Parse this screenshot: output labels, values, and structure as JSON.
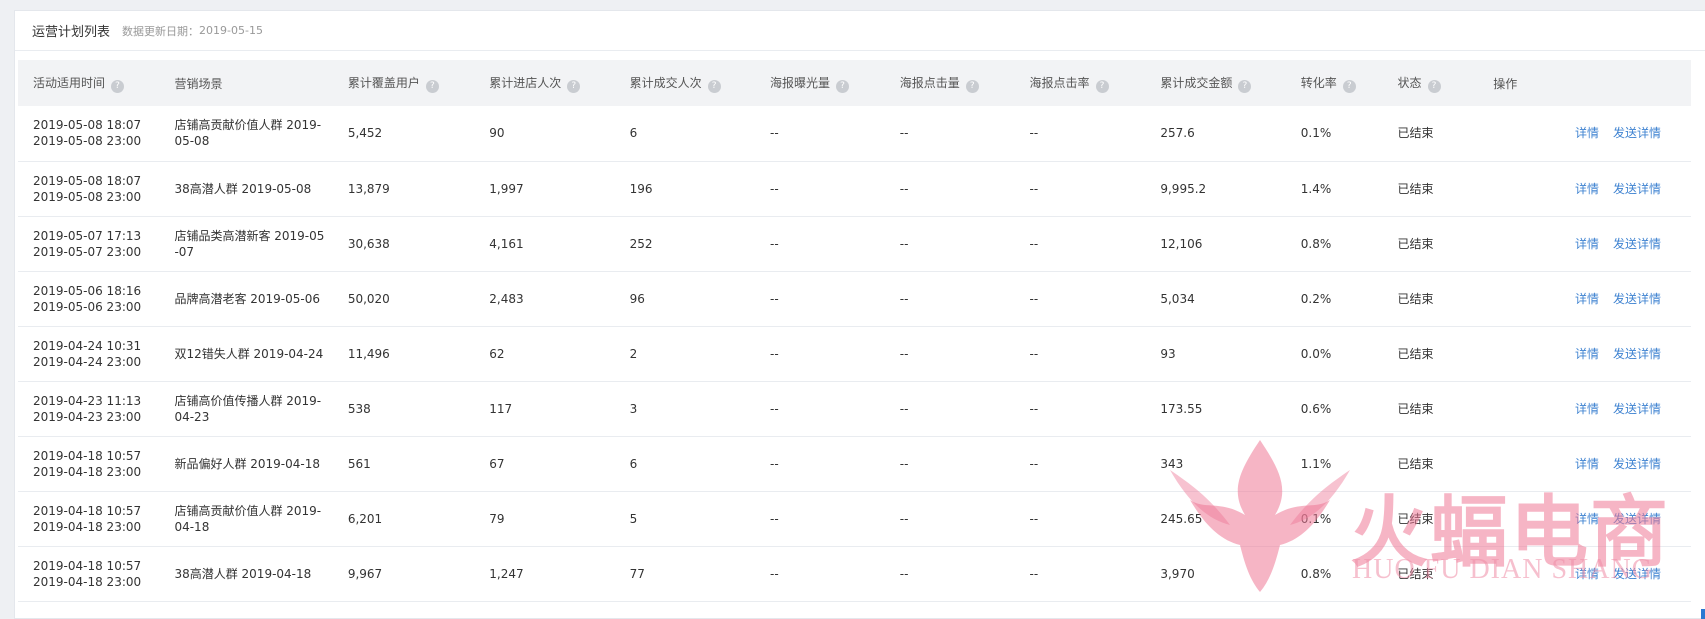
{
  "header": {
    "title": "运营计划列表",
    "update_label": "数据更新日期：",
    "update_date": "2019-05-15"
  },
  "columns": [
    {
      "label": "活动适用时间",
      "help": true
    },
    {
      "label": "营销场景",
      "help": false
    },
    {
      "label": "累计覆盖用户",
      "help": true
    },
    {
      "label": "累计进店人次",
      "help": true
    },
    {
      "label": "累计成交人次",
      "help": true
    },
    {
      "label": "海报曝光量",
      "help": true
    },
    {
      "label": "海报点击量",
      "help": true
    },
    {
      "label": "海报点击率",
      "help": true
    },
    {
      "label": "累计成交金额",
      "help": true
    },
    {
      "label": "转化率",
      "help": true
    },
    {
      "label": "状态",
      "help": true
    },
    {
      "label": "操作",
      "help": false
    }
  ],
  "help_glyph": "?",
  "ops": {
    "detail": "详情",
    "send_detail": "发送详情"
  },
  "rows": [
    {
      "start": "2019-05-08 18:07",
      "end": "2019-05-08 23:00",
      "scene": "店铺高贡献价值人群 2019-05-08",
      "cover": "5,452",
      "visits": "90",
      "deals": "6",
      "exposure": "--",
      "clicks": "--",
      "ctr": "--",
      "amount": "257.6",
      "conv": "0.1%",
      "status": "已结束"
    },
    {
      "start": "2019-05-08 18:07",
      "end": "2019-05-08 23:00",
      "scene": "38高潜人群 2019-05-08",
      "cover": "13,879",
      "visits": "1,997",
      "deals": "196",
      "exposure": "--",
      "clicks": "--",
      "ctr": "--",
      "amount": "9,995.2",
      "conv": "1.4%",
      "status": "已结束"
    },
    {
      "start": "2019-05-07 17:13",
      "end": "2019-05-07 23:00",
      "scene": "店铺品类高潜新客 2019-05-07",
      "cover": "30,638",
      "visits": "4,161",
      "deals": "252",
      "exposure": "--",
      "clicks": "--",
      "ctr": "--",
      "amount": "12,106",
      "conv": "0.8%",
      "status": "已结束"
    },
    {
      "start": "2019-05-06 18:16",
      "end": "2019-05-06 23:00",
      "scene": "品牌高潜老客 2019-05-06",
      "cover": "50,020",
      "visits": "2,483",
      "deals": "96",
      "exposure": "--",
      "clicks": "--",
      "ctr": "--",
      "amount": "5,034",
      "conv": "0.2%",
      "status": "已结束"
    },
    {
      "start": "2019-04-24 10:31",
      "end": "2019-04-24 23:00",
      "scene": "双12错失人群 2019-04-24",
      "cover": "11,496",
      "visits": "62",
      "deals": "2",
      "exposure": "--",
      "clicks": "--",
      "ctr": "--",
      "amount": "93",
      "conv": "0.0%",
      "status": "已结束"
    },
    {
      "start": "2019-04-23 11:13",
      "end": "2019-04-23 23:00",
      "scene": "店铺高价值传播人群 2019-04-23",
      "cover": "538",
      "visits": "117",
      "deals": "3",
      "exposure": "--",
      "clicks": "--",
      "ctr": "--",
      "amount": "173.55",
      "conv": "0.6%",
      "status": "已结束"
    },
    {
      "start": "2019-04-18 10:57",
      "end": "2019-04-18 23:00",
      "scene": "新品偏好人群 2019-04-18",
      "cover": "561",
      "visits": "67",
      "deals": "6",
      "exposure": "--",
      "clicks": "--",
      "ctr": "--",
      "amount": "343",
      "conv": "1.1%",
      "status": "已结束"
    },
    {
      "start": "2019-04-18 10:57",
      "end": "2019-04-18 23:00",
      "scene": "店铺高贡献价值人群 2019-04-18",
      "cover": "6,201",
      "visits": "79",
      "deals": "5",
      "exposure": "--",
      "clicks": "--",
      "ctr": "--",
      "amount": "245.65",
      "conv": "0.1%",
      "status": "已结束"
    },
    {
      "start": "2019-04-18 10:57",
      "end": "2019-04-18 23:00",
      "scene": "38高潜人群 2019-04-18",
      "cover": "9,967",
      "visits": "1,247",
      "deals": "77",
      "exposure": "--",
      "clicks": "--",
      "ctr": "--",
      "amount": "3,970",
      "conv": "0.8%",
      "status": "已结束"
    }
  ],
  "watermark": {
    "cn": "火蝠电商",
    "en": "HUO FU DIAN SHANG"
  },
  "colors": {
    "link": "#3f83d1",
    "header_bg": "#f2f3f5",
    "watermark": "#ee7896"
  }
}
